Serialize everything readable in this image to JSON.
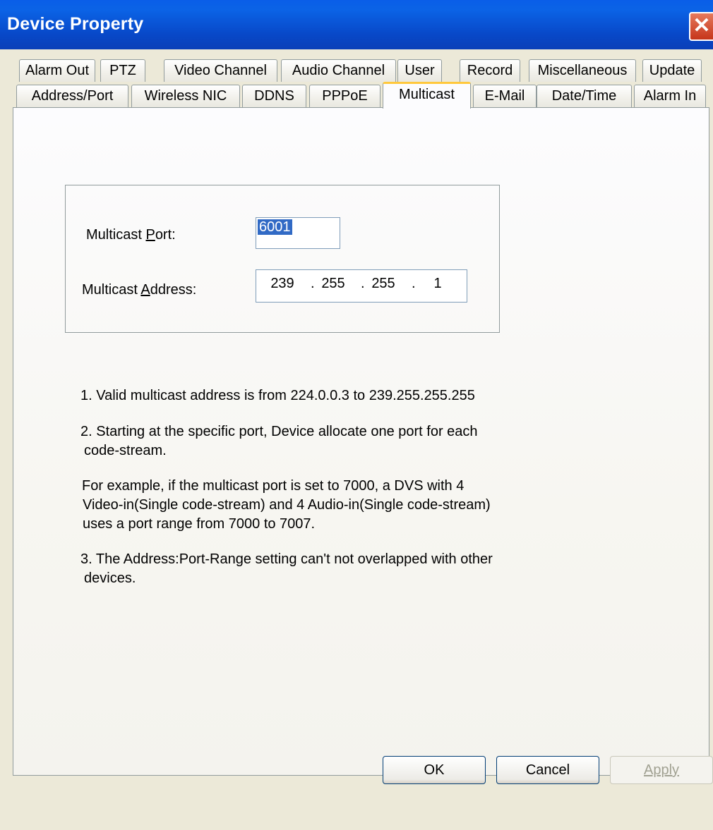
{
  "window": {
    "title": "Device Property"
  },
  "tabs": {
    "row_top": [
      "Alarm Out",
      "PTZ",
      "Video Channel",
      "Audio Channel",
      "User",
      "Record",
      "Miscellaneous",
      "Update"
    ],
    "row_bottom": [
      "Address/Port",
      "Wireless NIC",
      "DDNS",
      "PPPoE",
      "Multicast",
      "E-Mail",
      "Date/Time",
      "Alarm In"
    ],
    "active": "Multicast"
  },
  "multicast": {
    "port_label_pre": "Multicast ",
    "port_label_key": "P",
    "port_label_post": "ort:",
    "port_value": "6001",
    "address_label_pre": "Multicast ",
    "address_label_key": "A",
    "address_label_post": "ddress:",
    "address_octets": [
      "239",
      "255",
      "255",
      "1"
    ],
    "address_sep": "."
  },
  "notes": {
    "n1": "1. Valid multicast address is from 224.0.0.3 to 239.255.255.255",
    "n2_l1": "2. Starting at the specific port, Device allocate one port for each",
    "n2_l2": "code-stream.",
    "ex_l1": "For example, if the multicast port is set to 7000, a DVS with 4",
    "ex_l2": "Video-in(Single code-stream) and 4 Audio-in(Single code-stream)",
    "ex_l3": "uses a port range from 7000 to 7007.",
    "n3_l1": "3. The Address:Port-Range setting can't not overlapped with other",
    "n3_l2": "devices."
  },
  "buttons": {
    "ok": "OK",
    "cancel": "Cancel",
    "apply": "Apply"
  },
  "colors": {
    "titlebar": "#0a5ee8",
    "active_tab_accent": "#ffc83c",
    "selection": "#316ac5"
  }
}
